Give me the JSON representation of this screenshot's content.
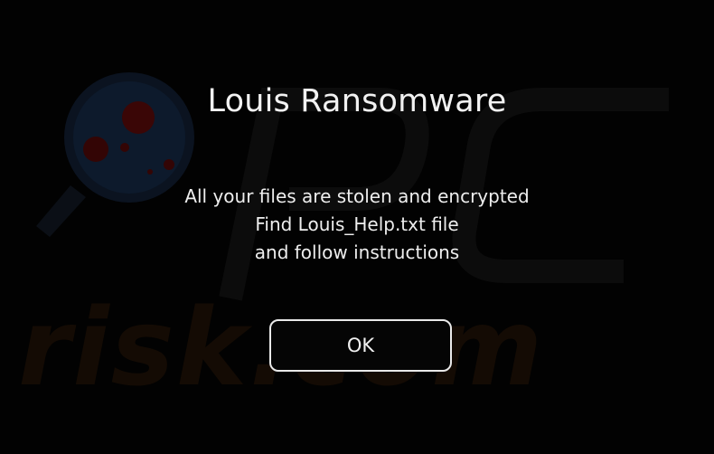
{
  "dialog": {
    "title": "Louis Ransomware",
    "message_lines": [
      "All your files are stolen and encrypted",
      "Find Louis_Help.txt file",
      "and follow instructions"
    ],
    "ok_label": "OK"
  },
  "colors": {
    "background": "#020202",
    "text": "#f2f2f2",
    "button_border": "#e9e9e9"
  },
  "watermark": {
    "text": "risk.com",
    "logo": "pcrisk-magnifier-logo"
  }
}
